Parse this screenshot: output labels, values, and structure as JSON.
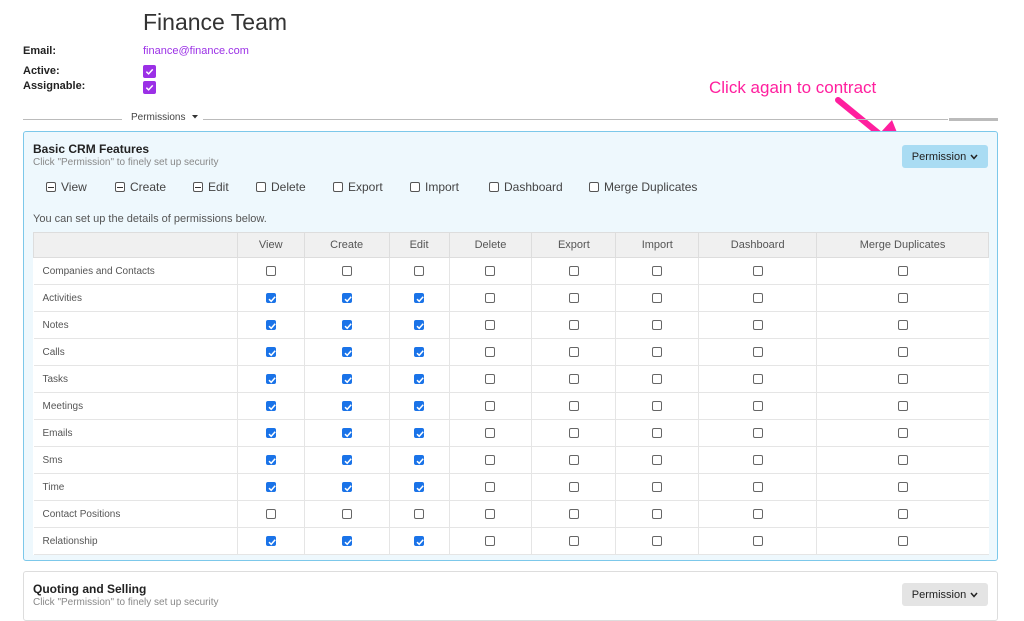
{
  "header": {
    "title": "Finance Team",
    "email_label": "Email:",
    "email_value": "finance@finance.com",
    "active_label": "Active:",
    "assignable_label": "Assignable:",
    "active_checked": true,
    "assignable_checked": true
  },
  "annotation": {
    "text": "Click again to contract",
    "color": "#ff1f9e"
  },
  "divider": {
    "label": "Permissions",
    "icon": "caret-down-icon"
  },
  "section1": {
    "title": "Basic CRM Features",
    "subtitle": "Click \"Permission\" to finely set up security",
    "button_label": "Permission",
    "button_icon": "chevron-down-icon",
    "toggles": [
      {
        "label": "View",
        "state": "partial"
      },
      {
        "label": "Create",
        "state": "partial"
      },
      {
        "label": "Edit",
        "state": "partial"
      },
      {
        "label": "Delete",
        "state": "unchecked"
      },
      {
        "label": "Export",
        "state": "unchecked"
      },
      {
        "label": "Import",
        "state": "unchecked"
      },
      {
        "label": "Dashboard",
        "state": "unchecked"
      },
      {
        "label": "Merge Duplicates",
        "state": "unchecked"
      }
    ],
    "hint": "You can set up the details of permissions below.",
    "columns": [
      "",
      "View",
      "Create",
      "Edit",
      "Delete",
      "Export",
      "Import",
      "Dashboard",
      "Merge Duplicates"
    ],
    "rows": [
      {
        "name": "Companies and Contacts",
        "checks": [
          false,
          false,
          false,
          false,
          false,
          false,
          false,
          false
        ]
      },
      {
        "name": "Activities",
        "checks": [
          true,
          true,
          true,
          false,
          false,
          false,
          false,
          false
        ]
      },
      {
        "name": "Notes",
        "checks": [
          true,
          true,
          true,
          false,
          false,
          false,
          false,
          false
        ]
      },
      {
        "name": "Calls",
        "checks": [
          true,
          true,
          true,
          false,
          false,
          false,
          false,
          false
        ]
      },
      {
        "name": "Tasks",
        "checks": [
          true,
          true,
          true,
          false,
          false,
          false,
          false,
          false
        ]
      },
      {
        "name": "Meetings",
        "checks": [
          true,
          true,
          true,
          false,
          false,
          false,
          false,
          false
        ]
      },
      {
        "name": "Emails",
        "checks": [
          true,
          true,
          true,
          false,
          false,
          false,
          false,
          false
        ]
      },
      {
        "name": "Sms",
        "checks": [
          true,
          true,
          true,
          false,
          false,
          false,
          false,
          false
        ]
      },
      {
        "name": "Time",
        "checks": [
          true,
          true,
          true,
          false,
          false,
          false,
          false,
          false
        ]
      },
      {
        "name": "Contact Positions",
        "checks": [
          false,
          false,
          false,
          false,
          false,
          false,
          false,
          false
        ]
      },
      {
        "name": "Relationship",
        "checks": [
          true,
          true,
          true,
          false,
          false,
          false,
          false,
          false
        ]
      }
    ]
  },
  "section2": {
    "title": "Quoting and Selling",
    "subtitle": "Click \"Permission\" to finely set up security",
    "button_label": "Permission",
    "button_icon": "chevron-down-icon"
  },
  "colors": {
    "accent_purple": "#9b30e6",
    "checkbox_blue": "#1a73e8",
    "section_bg": "#eef8fd",
    "section_border": "#7cc8ea",
    "button_blue": "#a9dcf3"
  }
}
